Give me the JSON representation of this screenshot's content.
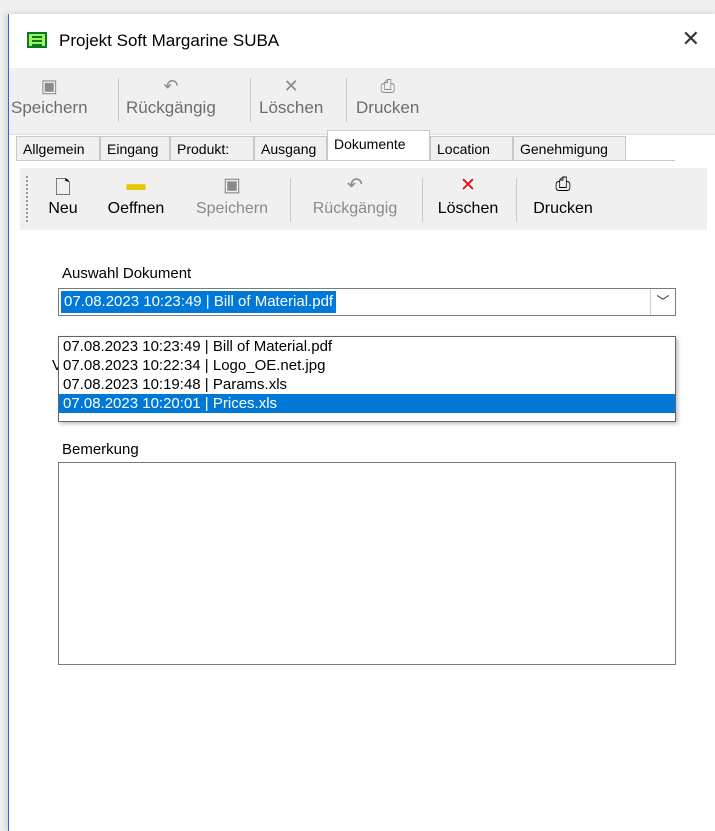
{
  "window": {
    "title": "Projekt Soft Margarine SUBA",
    "close_glyph": "✕"
  },
  "toolbar_main": [
    {
      "label": "Speichern",
      "icon": "save-icon",
      "glyph": "▣"
    },
    {
      "label": "Rückgängig",
      "icon": "undo-icon",
      "glyph": "↶"
    },
    {
      "label": "Löschen",
      "icon": "delete-icon",
      "glyph": "✕"
    },
    {
      "label": "Drucken",
      "icon": "print-icon",
      "glyph": "⎙"
    }
  ],
  "tabs": [
    "Allgemein",
    "Eingang",
    "Produkt:",
    "Ausgang",
    "Dokumente",
    "Location",
    "Genehmigung"
  ],
  "active_tab": "Dokumente",
  "toolbar_doc": [
    {
      "label": "Neu",
      "icon": "new-document-icon",
      "glyph": "🗋",
      "enabled": true
    },
    {
      "label": "Oeffnen",
      "icon": "open-folder-icon",
      "glyph": "▬",
      "enabled": true
    },
    {
      "label": "Speichern",
      "icon": "save-icon",
      "glyph": "▣",
      "enabled": false
    },
    {
      "label": "Rückgängig",
      "icon": "undo-icon",
      "glyph": "↶",
      "enabled": false
    },
    {
      "label": "Löschen",
      "icon": "delete-icon",
      "glyph": "✕",
      "enabled": true
    },
    {
      "label": "Drucken",
      "icon": "print-icon",
      "glyph": "⎙",
      "enabled": true
    }
  ],
  "document_select": {
    "label": "Auswahl Dokument",
    "selected_value": "07.08.2023 10:23:49  |  Bill of Material.pdf",
    "options": [
      "07.08.2023 10:23:49  |  Bill of Material.pdf",
      "07.08.2023 10:22:34  |  Logo_OE.net.jpg",
      "07.08.2023 10:19:48  |  Params.xls",
      "07.08.2023 10:20:01  |  Prices.xls"
    ],
    "highlighted_index": 3
  },
  "hidden_label_fragment": "V",
  "remark": {
    "label": "Bemerkung",
    "value": ""
  },
  "colors": {
    "accent": "#0078d7",
    "delete_red": "#e01010",
    "folder_yellow": "#e8c800",
    "disabled_gray": "#8a8a8a"
  }
}
